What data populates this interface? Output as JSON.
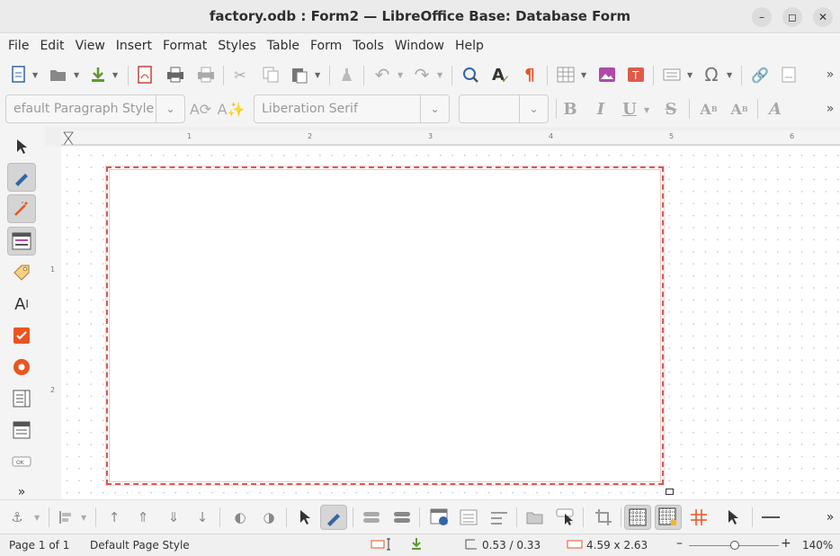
{
  "window": {
    "title": "factory.odb : Form2 — LibreOffice Base: Database Form",
    "controls": [
      "minimize-icon",
      "maximize-icon",
      "close-icon"
    ]
  },
  "menu": [
    "File",
    "Edit",
    "View",
    "Insert",
    "Format",
    "Styles",
    "Table",
    "Form",
    "Tools",
    "Window",
    "Help"
  ],
  "formatting": {
    "paragraph_style": "efault Paragraph Style",
    "font_name": "Liberation Serif",
    "font_size": ""
  },
  "ruler": {
    "h_numbers": [
      "1",
      "2",
      "3",
      "4",
      "5",
      "6"
    ],
    "v_numbers": [
      "1",
      "2"
    ]
  },
  "status": {
    "page": "Page 1 of 1",
    "page_style": "Default Page Style",
    "position": "0.53 / 0.33",
    "size": "4.59 x 2.63",
    "zoom": "140%"
  },
  "colors": {
    "form_border": "#d35b55",
    "accent_orange": "#e95420",
    "accent_blue": "#3465a4"
  }
}
